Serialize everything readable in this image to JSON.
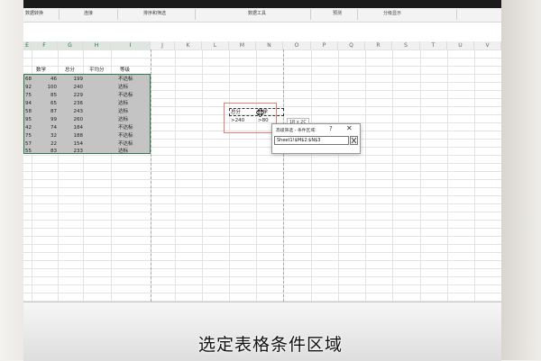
{
  "ribbon": {
    "groups": [
      "数据转换",
      "连接",
      "排序和筛选",
      "数据工具",
      "预测",
      "分级显示"
    ]
  },
  "columns": [
    "E",
    "F",
    "G",
    "H",
    "I",
    "J",
    "K",
    "L",
    "M",
    "N",
    "O",
    "P",
    "Q",
    "R",
    "S",
    "T",
    "U",
    "V"
  ],
  "table": {
    "headers": [
      "数学",
      "总分",
      "平均分",
      "等级"
    ],
    "rows": [
      [
        "68",
        "46",
        "199",
        "",
        "不达标"
      ],
      [
        "92",
        "100",
        "240",
        "",
        "达标"
      ],
      [
        "75",
        "85",
        "229",
        "",
        "不达标"
      ],
      [
        "94",
        "65",
        "236",
        "",
        "达标"
      ],
      [
        "58",
        "87",
        "243",
        "",
        "达标"
      ],
      [
        "95",
        "99",
        "260",
        "",
        "达标"
      ],
      [
        "42",
        "74",
        "184",
        "",
        "不达标"
      ],
      [
        "75",
        "32",
        "188",
        "",
        "不达标"
      ],
      [
        "57",
        "22",
        "154",
        "",
        "不达标"
      ],
      [
        "55",
        "83",
        "233",
        "",
        "达标"
      ]
    ]
  },
  "criteria": {
    "header1": "总分",
    "header2": "数学",
    "value1": ">240",
    "value2": ">80",
    "size_tip": "1R x 2C"
  },
  "dialog": {
    "title": "高级筛选 - 条件区域:",
    "help": "?",
    "close": "✕",
    "value": "Sheet1!$M$2:$N$3",
    "collapse_icon": "collapse-dialog-icon"
  },
  "caption": "选定表格条件区域"
}
